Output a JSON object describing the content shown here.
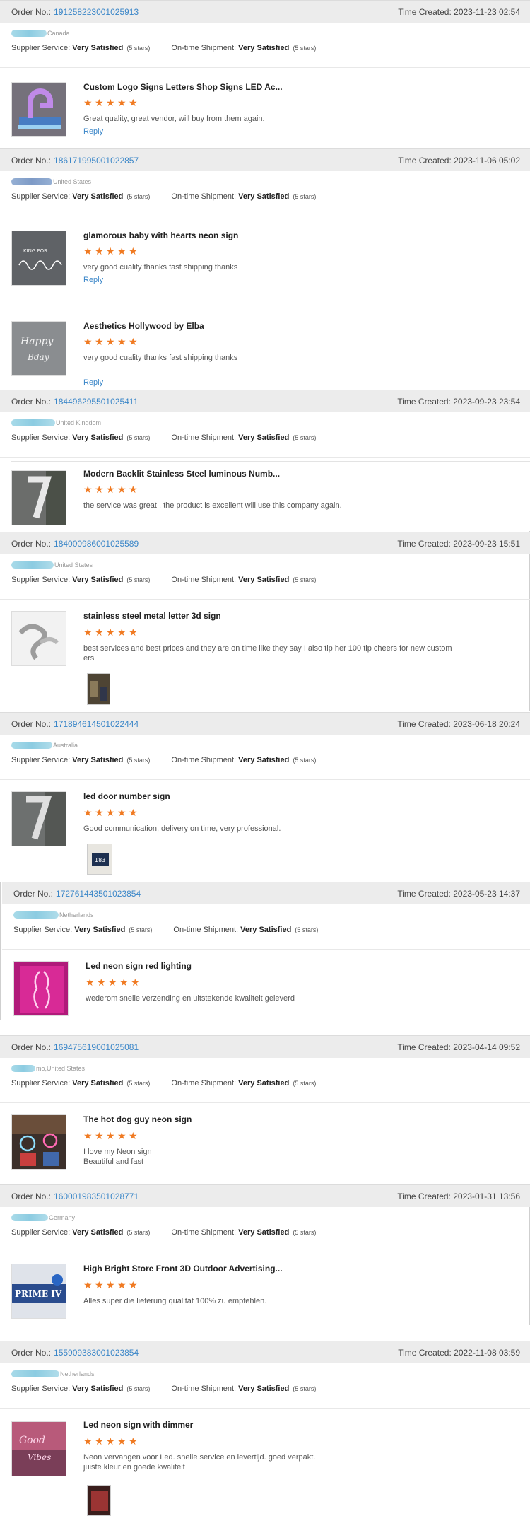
{
  "labels": {
    "order_no": "Order No.:",
    "time_created": "Time Created:",
    "supplier_service": "Supplier Service:",
    "ontime_shipment": "On-time Shipment:",
    "very_satisfied": "Very Satisfied",
    "five_stars": "(5 stars)",
    "reply": "Reply"
  },
  "star_color": "#f07a22",
  "link_color": "#3a86c8",
  "orders": [
    {
      "order_no": "191258223001025913",
      "time": "2023-11-23 02:54",
      "country": "Canada",
      "items": [
        {
          "title": "Custom Logo Signs Letters Shop Signs LED Ac...",
          "rating": 5,
          "review": "Great quality, great vendor, will buy from them again.",
          "reply": "Reply"
        }
      ]
    },
    {
      "order_no": "186171995001022857",
      "time": "2023-11-06 05:02",
      "country": "United States",
      "items": [
        {
          "title": "glamorous baby with hearts neon sign",
          "rating": 5,
          "review": "very good cuality thanks fast shipping thanks",
          "reply": "Reply"
        },
        {
          "title": "Aesthetics Hollywood by Elba",
          "rating": 5,
          "review": "very good cuality thanks fast shipping thanks",
          "reply": "Reply"
        }
      ]
    },
    {
      "order_no": "184496295501025411",
      "time": "2023-09-23 23:54",
      "country": "United Kingdom",
      "items": [
        {
          "title": "Modern Backlit Stainless Steel luminous Numb...",
          "rating": 5,
          "review": "the service was great . the product is excellent will use this company again."
        }
      ]
    },
    {
      "order_no": "184000986001025589",
      "time": "2023-09-23 15:51",
      "country": "United States",
      "items": [
        {
          "title": "stainless steel metal letter 3d sign",
          "rating": 5,
          "review": "best services and best prices and they are on time like they say I also tip her 100 tip cheers for new custom ers"
        }
      ]
    },
    {
      "order_no": "171894614501022444",
      "time": "2023-06-18 20:24",
      "country": "Australia",
      "items": [
        {
          "title": "led door number sign",
          "rating": 5,
          "review": "Good communication, delivery on time, very professional."
        }
      ]
    },
    {
      "order_no": "172761443501023854",
      "time": "2023-05-23 14:37",
      "country": "Netherlands",
      "items": [
        {
          "title": "Led neon sign red lighting",
          "rating": 5,
          "review": "wederom snelle verzending en uitstekende kwaliteit geleverd"
        }
      ]
    },
    {
      "order_no": "169475619001025081",
      "time": "2023-04-14 09:52",
      "country": "mo,United States",
      "items": [
        {
          "title": "The hot dog guy neon sign",
          "rating": 5,
          "review_lines": [
            "I love my Neon sign",
            "Beautiful and fast"
          ]
        }
      ]
    },
    {
      "order_no": "160001983501028771",
      "time": "2023-01-31 13:56",
      "country": "Germany",
      "items": [
        {
          "title": "High Bright Store Front 3D Outdoor Advertising...",
          "rating": 5,
          "review": "Alles super die lieferung qualitat 100% zu empfehlen."
        }
      ]
    },
    {
      "order_no": "155909383001023854",
      "time": "2022-11-08 03:59",
      "country": "Netherlands",
      "items": [
        {
          "title": "Led neon sign with dimmer",
          "rating": 5,
          "review_lines": [
            "Neon vervangen voor Led. snelle service en levertijd. goed verpakt.",
            "juiste kleur en goede kwaliteit"
          ]
        }
      ]
    }
  ]
}
